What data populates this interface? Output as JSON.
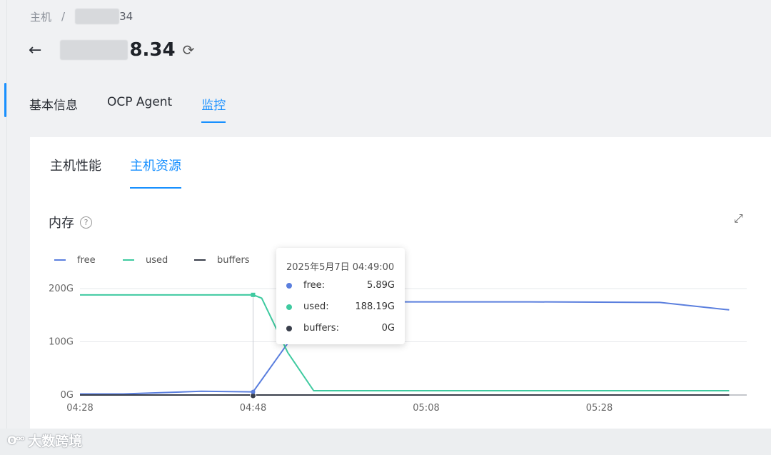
{
  "breadcrumb": {
    "root": "主机",
    "separator": "/",
    "current_suffix": "34"
  },
  "page": {
    "title_suffix": "8.34",
    "back_icon": "arrow-left-icon",
    "refresh_icon": "refresh-icon"
  },
  "tabs": [
    {
      "label": "基本信息",
      "active": false
    },
    {
      "label": "OCP Agent",
      "active": false
    },
    {
      "label": "监控",
      "active": true
    }
  ],
  "subtabs": [
    {
      "label": "主机性能",
      "active": false
    },
    {
      "label": "主机资源",
      "active": true
    }
  ],
  "section": {
    "title": "内存",
    "help_icon": "question-circle-icon",
    "expand_icon": "fullscreen-icon"
  },
  "chart_data": {
    "type": "line",
    "title": "内存",
    "x_ticks": [
      "04:28",
      "04:48",
      "05:08",
      "05:28"
    ],
    "y_ticks": [
      "0G",
      "100G",
      "200G"
    ],
    "ylim": [
      0,
      200
    ],
    "unit": "G",
    "grid": true,
    "legend_position": "top-left",
    "series": [
      {
        "name": "free",
        "color": "#5b7fde",
        "points": [
          [
            "04:28",
            2
          ],
          [
            "04:33",
            2
          ],
          [
            "04:42",
            7
          ],
          [
            "04:48",
            5.89
          ],
          [
            "04:52",
            97
          ],
          [
            "04:58",
            175
          ],
          [
            "05:20",
            175
          ],
          [
            "05:35",
            174
          ],
          [
            "05:43",
            160
          ]
        ]
      },
      {
        "name": "used",
        "color": "#3fcaa0",
        "points": [
          [
            "04:28",
            188
          ],
          [
            "04:42",
            188
          ],
          [
            "04:48",
            188.19
          ],
          [
            "04:49",
            182
          ],
          [
            "04:52",
            80
          ],
          [
            "04:55",
            8
          ],
          [
            "05:20",
            8
          ],
          [
            "05:43",
            8
          ]
        ]
      },
      {
        "name": "buffers",
        "color": "#3a3f4b",
        "points": [
          [
            "04:28",
            0
          ],
          [
            "05:43",
            0
          ]
        ]
      }
    ],
    "tooltip": {
      "title": "2025年5月7日 04:49:00",
      "rows": [
        {
          "name": "free:",
          "value": "5.89G",
          "color": "#5b7fde"
        },
        {
          "name": "used:",
          "value": "188.19G",
          "color": "#3fcaa0"
        },
        {
          "name": "buffers:",
          "value": "0G",
          "color": "#3a3f4b"
        }
      ]
    }
  },
  "watermark": {
    "text": "大数跨境"
  }
}
